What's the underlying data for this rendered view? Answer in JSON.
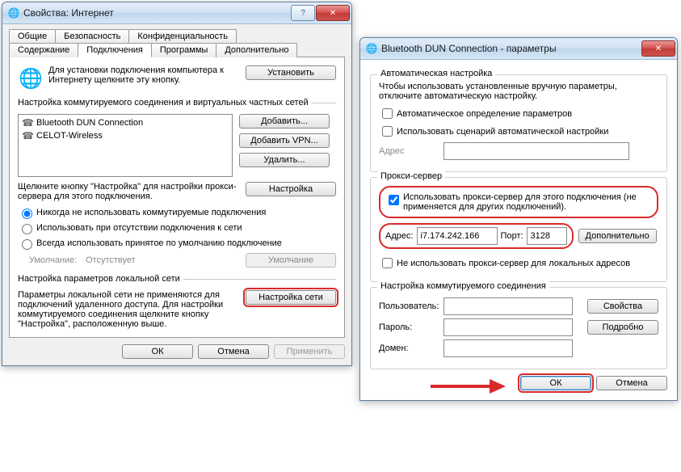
{
  "win1": {
    "title": "Свойства: Интернет",
    "tabs_row1": [
      "Общие",
      "Безопасность",
      "Конфиденциальность"
    ],
    "tabs_row2": [
      "Содержание",
      "Подключения",
      "Программы",
      "Дополнительно"
    ],
    "active_tab": "Подключения",
    "setup_text": "Для установки подключения компьютера к Интернету щелкните эту кнопку.",
    "btn_install": "Установить",
    "dial_title": "Настройка коммутируемого соединения и виртуальных частных сетей",
    "connections": [
      "Bluetooth DUN Connection",
      "CELOT-Wireless"
    ],
    "btn_add": "Добавить...",
    "btn_add_vpn": "Добавить VPN...",
    "btn_remove": "Удалить...",
    "settings_hint": "Щелкните кнопку \"Настройка\" для настройки прокси-сервера для этого подключения.",
    "btn_settings": "Настройка",
    "radio1": "Никогда не использовать коммутируемые подключения",
    "radio2": "Использовать при отсутствии подключения к сети",
    "radio3": "Всегда использовать принятое по умолчанию подключение",
    "default_lbl": "Умолчание:",
    "default_val": "Отсутствует",
    "btn_default": "Умолчание",
    "lan_title": "Настройка параметров локальной сети",
    "lan_text": "Параметры локальной сети не применяются для подключений удаленного доступа. Для настройки коммутируемого соединения щелкните кнопку \"Настройка\", расположенную выше.",
    "btn_lan": "Настройка сети",
    "btn_ok": "ОК",
    "btn_cancel": "Отмена",
    "btn_apply": "Применить"
  },
  "win2": {
    "title": "Bluetooth DUN Connection - параметры",
    "auto_title": "Автоматическая настройка",
    "auto_text": "Чтобы использовать установленные вручную параметры, отключите автоматическую настройку.",
    "chk_auto": "Автоматическое определение параметров",
    "chk_script": "Использовать сценарий автоматической настройки",
    "addr_lbl": "Адрес",
    "proxy_title": "Прокси-сервер",
    "chk_proxy": "Использовать прокси-сервер для этого подключения (не применяется для других подключений).",
    "proxy_addr_lbl": "Адрес:",
    "proxy_addr_val": "i7.174.242.166",
    "proxy_port_lbl": "Порт:",
    "proxy_port_val": "3128",
    "btn_adv": "Дополнительно",
    "chk_local": "Не использовать прокси-сервер для локальных адресов",
    "dial_title": "Настройка коммутируемого соединения",
    "user_lbl": "Пользователь:",
    "pass_lbl": "Пароль:",
    "domain_lbl": "Домен:",
    "btn_props": "Свойства",
    "btn_more": "Подробно",
    "btn_ok": "ОК",
    "btn_cancel": "Отмена"
  }
}
